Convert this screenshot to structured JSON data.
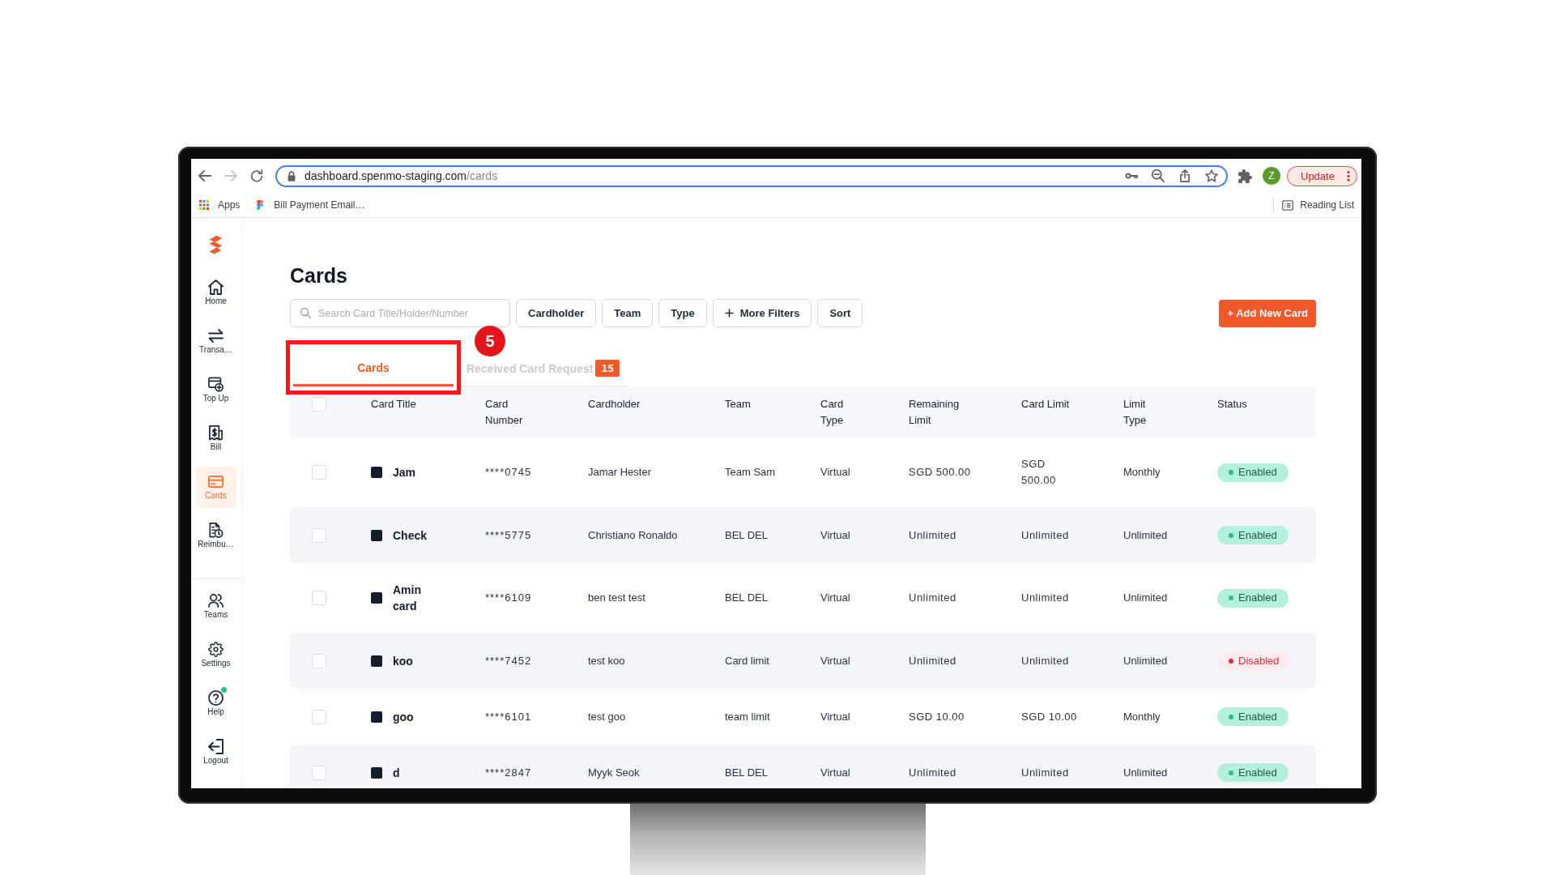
{
  "browser": {
    "nav_buttons": [
      {
        "kind": "back",
        "disabled": false
      },
      {
        "kind": "forward",
        "disabled": true
      },
      {
        "kind": "reload",
        "disabled": false
      }
    ],
    "url_host": "dashboard.spenmo-staging.com",
    "url_path": "/cards",
    "profile_initial": "Z",
    "update_label": "Update",
    "bookmarks": [
      {
        "kind": "apps",
        "label": "Apps"
      },
      {
        "kind": "page",
        "label": "Bill Payment Email…"
      }
    ],
    "reading_list": "Reading List"
  },
  "sidebar": {
    "items": [
      {
        "kind": "home",
        "label": "Home",
        "selected": false,
        "notification": false
      },
      {
        "kind": "transactions",
        "label": "Transa…",
        "selected": false,
        "notification": false
      },
      {
        "kind": "top_up",
        "label": "Top Up",
        "selected": false,
        "notification": false
      },
      {
        "kind": "bill",
        "label": "Bill",
        "selected": false,
        "notification": false
      },
      {
        "kind": "cards",
        "label": "Cards",
        "selected": true,
        "notification": false
      },
      {
        "kind": "reimbursement",
        "label": "Reimbu…",
        "selected": false,
        "notification": false
      }
    ],
    "bottom_items": [
      {
        "kind": "teams",
        "label": "Teams",
        "selected": false,
        "notification": false
      },
      {
        "kind": "settings",
        "label": "Settings",
        "selected": false,
        "notification": false
      },
      {
        "kind": "help",
        "label": "Help",
        "selected": false,
        "notification": true
      },
      {
        "kind": "logout",
        "label": "Logout",
        "selected": false,
        "notification": false
      }
    ]
  },
  "page": {
    "title": "Cards",
    "search": {
      "placeholder": "Search Card Title/Holder/Number"
    },
    "filters": [
      {
        "kind": "filter",
        "label": "Cardholder"
      },
      {
        "kind": "filter",
        "label": "Team"
      },
      {
        "kind": "filter",
        "label": "Type"
      },
      {
        "kind": "add",
        "label": "More Filters"
      },
      {
        "kind": "sort",
        "label": "Sort"
      }
    ],
    "add_button": "+ Add New Card",
    "tabs": [
      {
        "label": "Cards",
        "selected": true
      },
      {
        "label": "Received Card Request",
        "selected": false,
        "count": "15"
      }
    ],
    "annotation": {
      "marker": "5"
    }
  },
  "table": {
    "select_all": {
      "checked": false
    },
    "columns": [
      "Card Title",
      "Card Number",
      "Cardholder",
      "Team",
      "Card Type",
      "Remaining Limit",
      "Card Limit",
      "Limit Type",
      "Status"
    ],
    "rows": [
      {
        "checked": false,
        "color": "#161c2c",
        "title": "Jam",
        "number": "****0745",
        "cardholder": "Jamar Hester",
        "team": "Team Sam",
        "card_type": "Virtual",
        "remaining_limit": "SGD 500.00",
        "card_limit": "SGD 500.00",
        "limit_type": "Monthly",
        "status": {
          "label": "Enabled",
          "kind": "enabled"
        }
      },
      {
        "checked": false,
        "color": "#161c2c",
        "title": "Check",
        "number": "****5775",
        "cardholder": "Christiano Ronaldo",
        "team": "BEL DEL",
        "card_type": "Virtual",
        "remaining_limit": "Unlimited",
        "card_limit": "Unlimited",
        "limit_type": "Unlimited",
        "status": {
          "label": "Enabled",
          "kind": "enabled"
        }
      },
      {
        "checked": false,
        "color": "#161c2c",
        "title": "Amin card",
        "number": "****6109",
        "cardholder": "ben test test",
        "team": "BEL DEL",
        "card_type": "Virtual",
        "remaining_limit": "Unlimited",
        "card_limit": "Unlimited",
        "limit_type": "Unlimited",
        "status": {
          "label": "Enabled",
          "kind": "enabled"
        }
      },
      {
        "checked": false,
        "color": "#161c2c",
        "title": "koo",
        "number": "****7452",
        "cardholder": "test koo",
        "team": "Card limit",
        "card_type": "Virtual",
        "remaining_limit": "Unlimited",
        "card_limit": "Unlimited",
        "limit_type": "Unlimited",
        "status": {
          "label": "Disabled",
          "kind": "disabled"
        }
      },
      {
        "checked": false,
        "color": "#161c2c",
        "title": "goo",
        "number": "****6101",
        "cardholder": "test goo",
        "team": "team limit",
        "card_type": "Virtual",
        "remaining_limit": "SGD 10.00",
        "card_limit": "SGD 10.00",
        "limit_type": "Monthly",
        "status": {
          "label": "Enabled",
          "kind": "enabled"
        }
      },
      {
        "checked": false,
        "color": "#161c2c",
        "title": "d",
        "number": "****2847",
        "cardholder": "Myyk Seok",
        "team": "BEL DEL",
        "card_type": "Virtual",
        "remaining_limit": "Unlimited",
        "card_limit": "Unlimited",
        "limit_type": "Unlimited",
        "status": {
          "label": "Enabled",
          "kind": "enabled"
        }
      }
    ]
  }
}
